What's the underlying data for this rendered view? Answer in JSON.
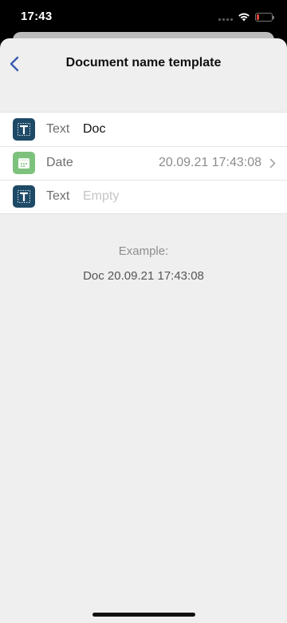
{
  "status_bar": {
    "time": "17:43"
  },
  "header": {
    "title": "Document name template"
  },
  "rows": [
    {
      "label": "Text",
      "value": "Doc",
      "icon": "text-icon"
    },
    {
      "label": "Date",
      "value": "20.09.21 17:43:08",
      "icon": "calendar-icon"
    },
    {
      "label": "Text",
      "placeholder": "Empty",
      "icon": "text-icon"
    }
  ],
  "example": {
    "label": "Example:",
    "value": "Doc 20.09.21 17:43:08"
  },
  "colors": {
    "accent": "#3a5bb0",
    "text_icon_bg": "#1e4a66",
    "date_icon_bg": "#7dc27c",
    "background": "#efefef"
  }
}
